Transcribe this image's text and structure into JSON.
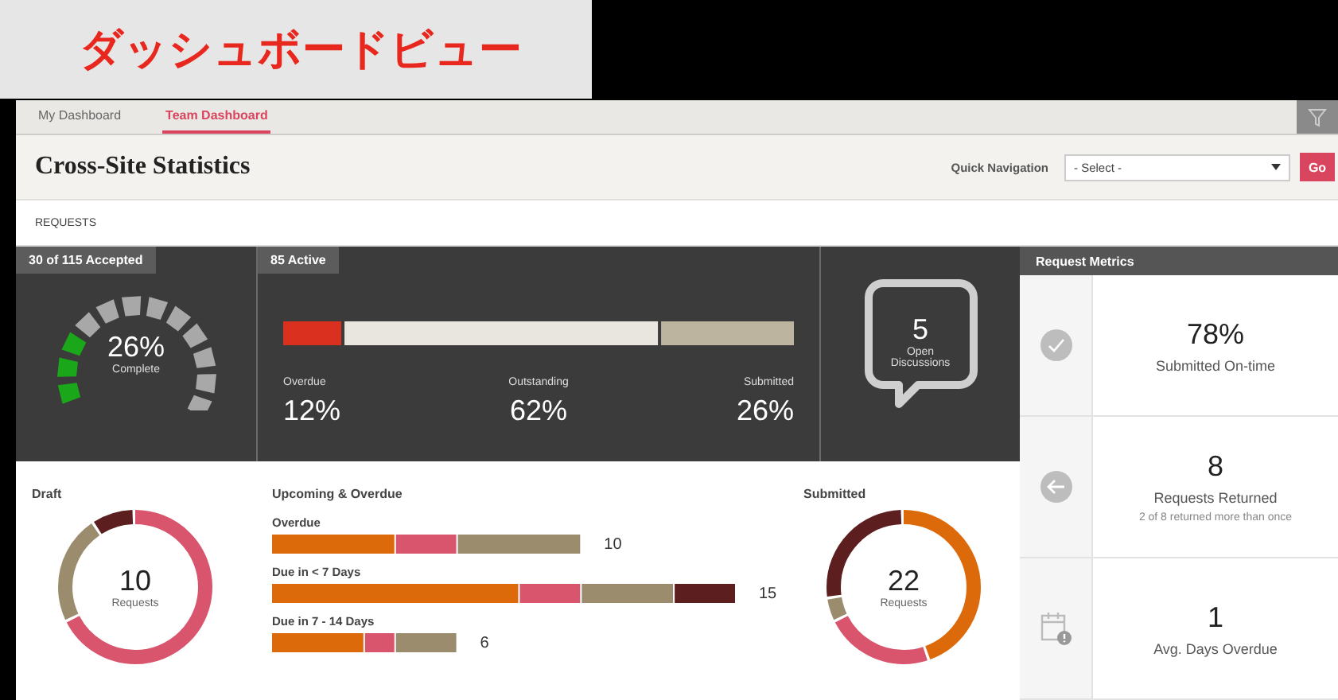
{
  "banner": {
    "title": "ダッシュボードビュー"
  },
  "tabs": [
    {
      "label": "My Dashboard",
      "selected": false
    },
    {
      "label": "Team Dashboard",
      "selected": true
    }
  ],
  "header": {
    "title": "Cross-Site Statistics",
    "quick_nav_label": "Quick Navigation",
    "select_value": "- Select -",
    "go_button": "Go"
  },
  "section_label": "REQUESTS",
  "accepted_panel": {
    "tag": "30 of 115 Accepted",
    "value": "26%",
    "caption": "Complete",
    "level": 0.26
  },
  "active_panel": {
    "tag": "85 Active",
    "legend": [
      {
        "label": "Overdue",
        "value": "12%"
      },
      {
        "label": "Outstanding",
        "value": "62%"
      },
      {
        "label": "Submitted",
        "value": "26%"
      }
    ]
  },
  "discussions": {
    "count": "5",
    "label": "Open Discussions"
  },
  "draft": {
    "title": "Draft",
    "count": "10",
    "caption": "Requests"
  },
  "upcoming": {
    "title": "Upcoming & Overdue",
    "rows": [
      {
        "label": "Overdue",
        "total": "10"
      },
      {
        "label": "Due in < 7 Days",
        "total": "15"
      },
      {
        "label": "Due in 7 - 14 Days",
        "total": "6"
      }
    ]
  },
  "submitted": {
    "title": "Submitted",
    "count": "22",
    "caption": "Requests"
  },
  "metrics": {
    "title": "Request Metrics",
    "items": [
      {
        "kind": "check",
        "value": "78%",
        "label": "Submitted On-time"
      },
      {
        "kind": "return",
        "value": "8",
        "label": "Requests Returned",
        "note": "2 of 8 returned more than once"
      },
      {
        "kind": "calendar",
        "value": "1",
        "label": "Avg. Days Overdue"
      }
    ]
  }
}
